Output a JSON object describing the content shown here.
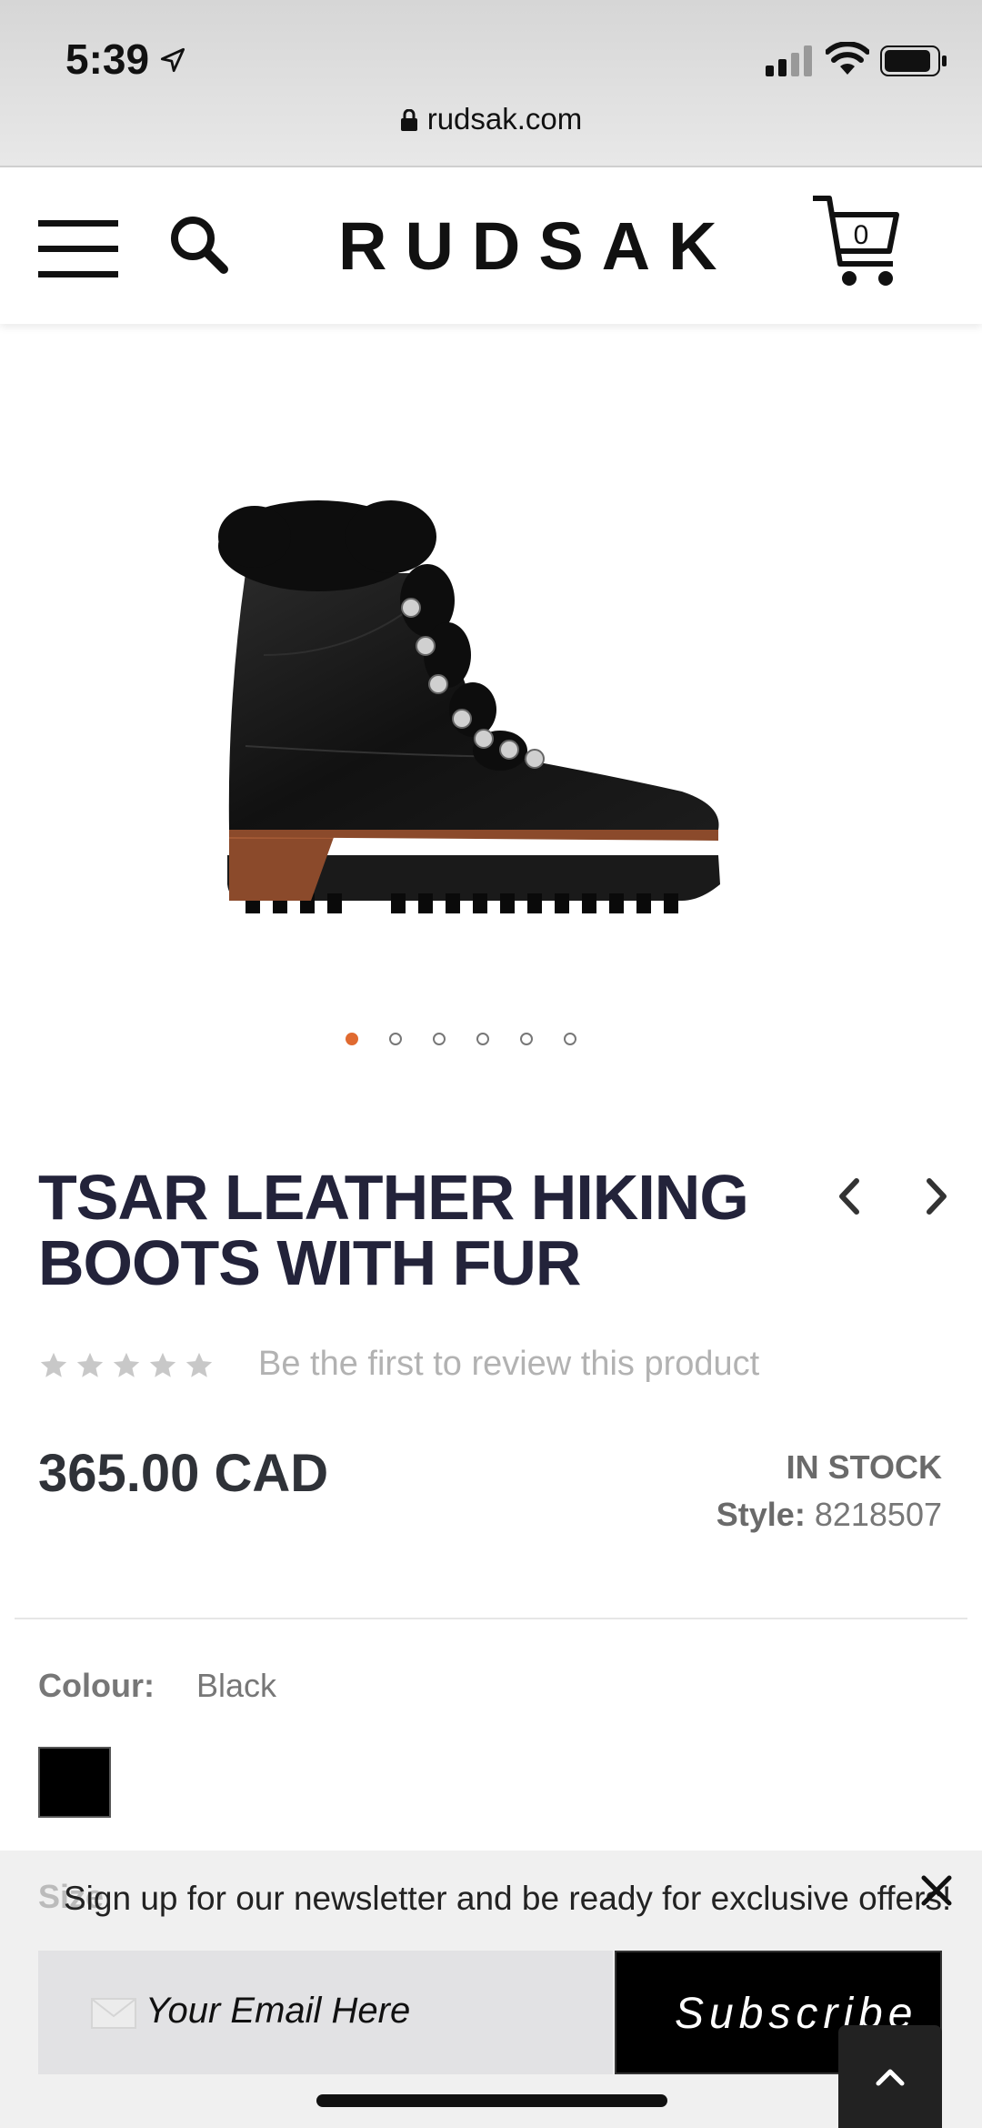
{
  "status_bar": {
    "time": "5:39",
    "url": "rudsak.com"
  },
  "header": {
    "logo": "RUDSAK",
    "cart_count": "0"
  },
  "product": {
    "image_alt": "black leather hiking boot with fur trim",
    "carousel": {
      "total": 6,
      "active_index": 0
    },
    "title": "TSAR LEATHER HIKING BOOTS WITH FUR",
    "rating": {
      "stars": 5,
      "filled": 0,
      "review_text": "Be the first to review this product"
    },
    "price": "365.00 CAD",
    "stock_status": "IN STOCK",
    "style_label": "Style:",
    "style_number": "8218507",
    "colour_label": "Colour:",
    "colour_value": "Black",
    "size_label": "Size"
  },
  "newsletter": {
    "message": "Sign up for our newsletter and be ready for exclusive offers!",
    "email_placeholder": "Your Email Here",
    "subscribe_label": "Subscribe"
  },
  "colors": {
    "accent_dot": "#e06a30",
    "title": "#23233a",
    "swatch": "#000000"
  }
}
